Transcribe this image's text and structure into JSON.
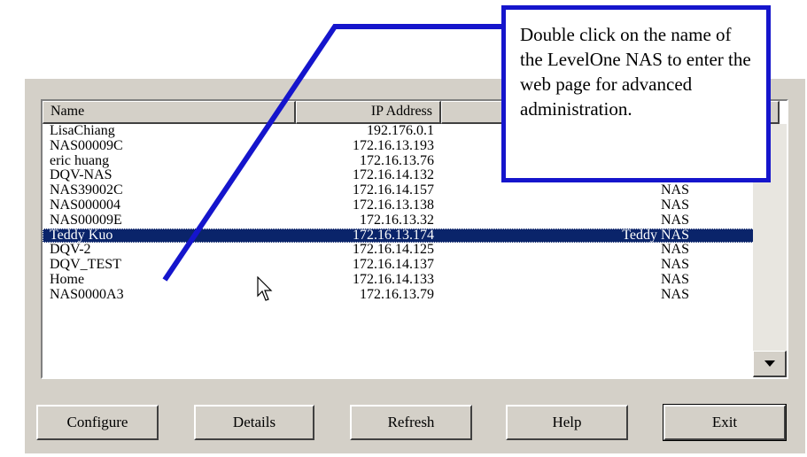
{
  "list": {
    "columns": {
      "name": "Name",
      "ip": "IP Address",
      "type": ""
    },
    "rows": [
      {
        "name": "LisaChiang",
        "ip": "192.176.0.1",
        "type": ""
      },
      {
        "name": "NAS00009C",
        "ip": "172.16.13.193",
        "type": ""
      },
      {
        "name": "eric huang",
        "ip": "172.16.13.76",
        "type": ""
      },
      {
        "name": "DQV-NAS",
        "ip": "172.16.14.132",
        "type": "NAS"
      },
      {
        "name": "NAS39002C",
        "ip": "172.16.14.157",
        "type": "NAS"
      },
      {
        "name": "NAS000004",
        "ip": "172.16.13.138",
        "type": "NAS"
      },
      {
        "name": "NAS00009E",
        "ip": "172.16.13.32",
        "type": "NAS"
      },
      {
        "name": "Teddy Kuo",
        "ip": "172.16.13.174",
        "type": "Teddy NAS"
      },
      {
        "name": "DQV-2",
        "ip": "172.16.14.125",
        "type": "NAS"
      },
      {
        "name": "DQV_TEST",
        "ip": "172.16.14.137",
        "type": "NAS"
      },
      {
        "name": "Home",
        "ip": "172.16.14.133",
        "type": "NAS"
      },
      {
        "name": "NAS0000A3",
        "ip": "172.16.13.79",
        "type": "NAS"
      }
    ],
    "selected_index": 7
  },
  "buttons": {
    "configure": "Configure",
    "details": "Details",
    "refresh": "Refresh",
    "help": "Help",
    "exit": "Exit"
  },
  "callout": {
    "text": "Double click on the name of the LevelOne NAS to enter the web page for advanced administration."
  },
  "colors": {
    "selection": "#0a246a",
    "callout_border": "#1515cc",
    "dialog": "#d4d0c8"
  },
  "icons": [
    "scroll-down-arrow-icon",
    "mouse-cursor-icon"
  ]
}
